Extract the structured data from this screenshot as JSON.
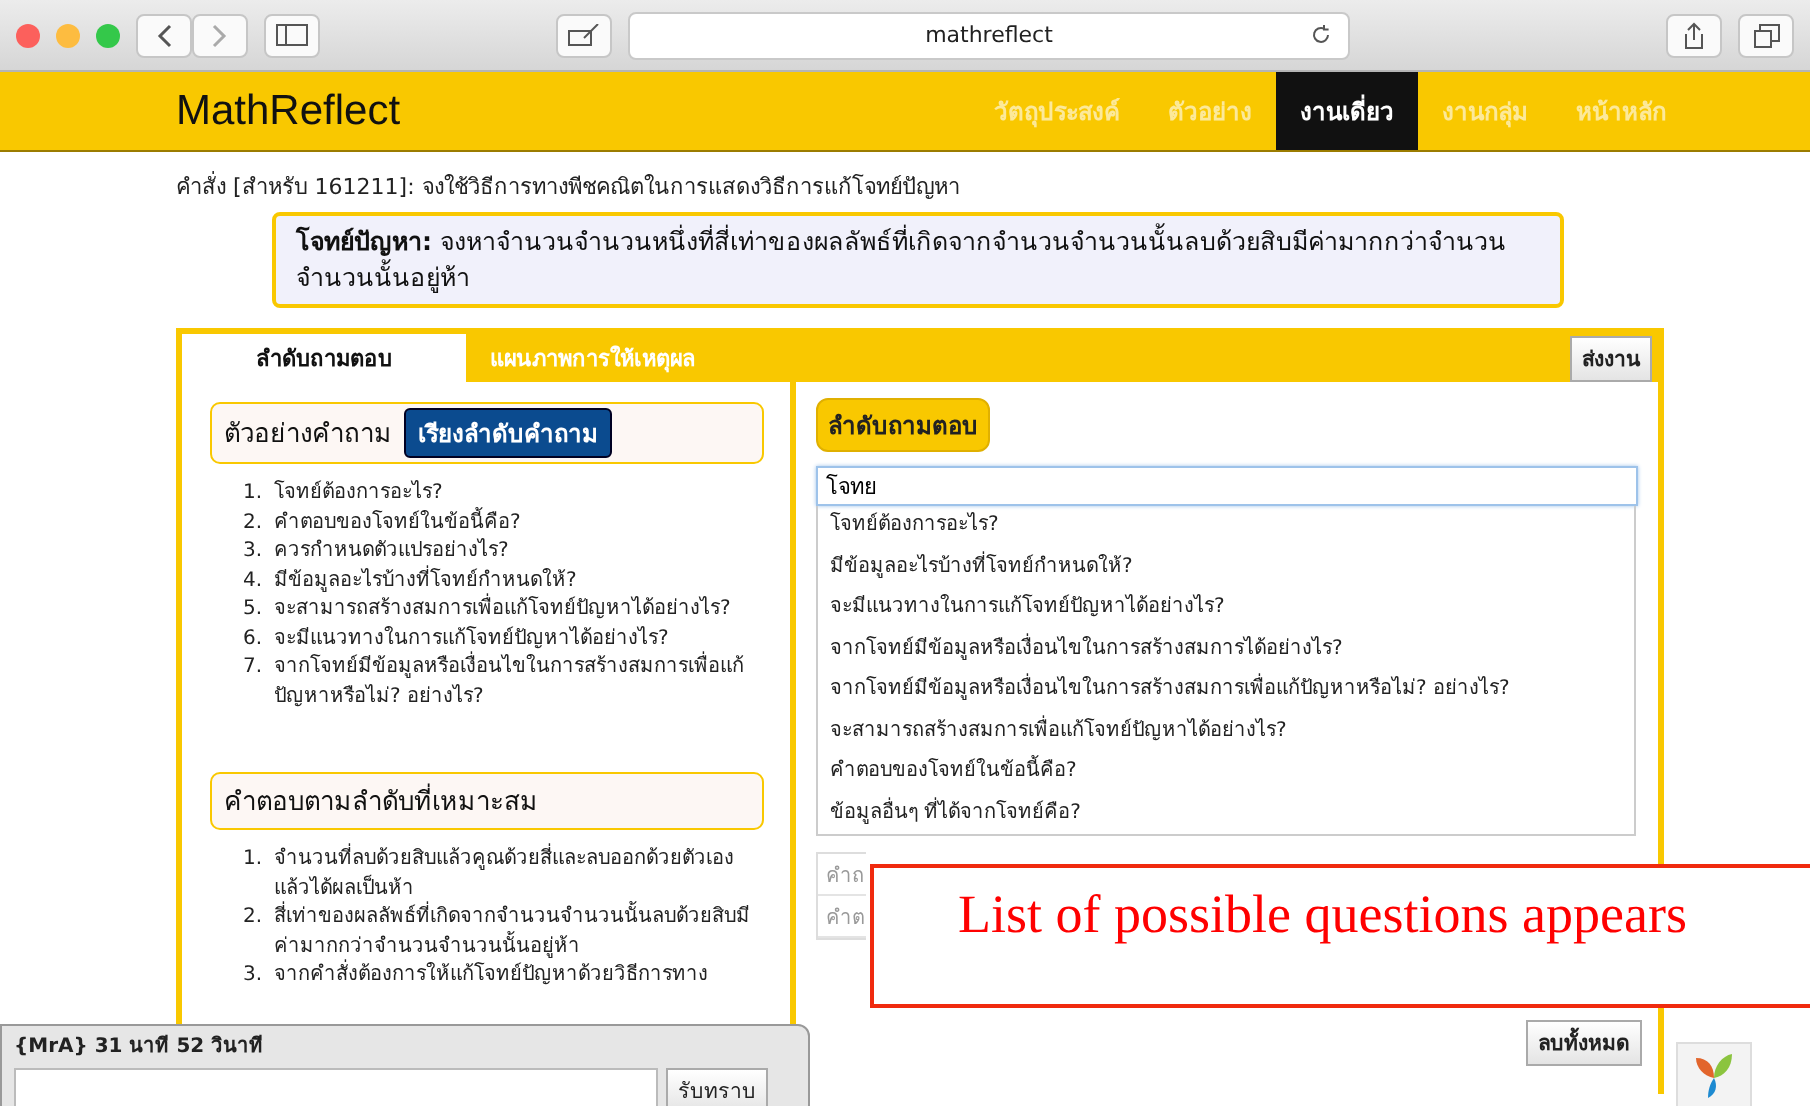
{
  "browser": {
    "url": "mathreflect"
  },
  "nav": {
    "logo": "MathReflect",
    "items": [
      {
        "label": "วัตถุประสงค์",
        "selected": false
      },
      {
        "label": "ตัวอย่าง",
        "selected": false
      },
      {
        "label": "งานเดี่ยว",
        "selected": true
      },
      {
        "label": "งานกลุ่ม",
        "selected": false
      },
      {
        "label": "หน้าหลัก",
        "selected": false
      }
    ]
  },
  "instruction": "คำสั่ง [สำหรับ 161211]: จงใช้วิธีการทางพีชคณิตในการแสดงวิธีการแก้โจทย์ปัญหา",
  "problem": "**โจทย์ปัญหา:** จงหาจำนวนจำนวนหนึ่งที่สี่เท่าของผลลัพธ์ที่เกิดจากจำนวนจำนวนนั้นลบด้วยสิบมีค่ามากกว่าจำนวนจำนวนนั้นอยู่ห้า",
  "tabs": [
    {
      "label": "ลำดับถามตอบ",
      "selected": true
    },
    {
      "label": "แผนภาพการให้เหตุผล",
      "selected": false
    }
  ],
  "submit_button": "ส่งงาน",
  "examples": {
    "title": "ตัวอย่างคำถาม",
    "sort_button": "เรียงลำดับคำถาม",
    "items": [
      {
        "number": "1.",
        "text": "โจทย์ต้องการอะไร?"
      },
      {
        "number": "2.",
        "text": "คำตอบของโจทย์ในข้อนี้คือ?"
      },
      {
        "number": "3.",
        "text": "ควรกำหนดตัวแปรอย่างไร?"
      },
      {
        "number": "4.",
        "text": "มีข้อมูลอะไรบ้างที่โจทย์กำหนดให้?"
      },
      {
        "number": "5.",
        "text": "จะสามารถสร้างสมการเพื่อแก้โจทย์ปัญหาได้อย่างไร?"
      },
      {
        "number": "6.",
        "text": "จะมีแนวทางในการแก้โจทย์ปัญหาได้อย่างไร?"
      },
      {
        "number": "7.",
        "text": "จากโจทย์มีข้อมูลหรือเงื่อนไขในการสร้างสมการเพื่อแก้ปัญหาหรือไม่? อย่างไร?"
      }
    ]
  },
  "answers": {
    "title": "คำตอบตามลำดับที่เหมาะสม",
    "items": [
      {
        "number": "1.",
        "text": "จำนวนที่ลบด้วยสิบแล้วคูณด้วยสี่และลบออกด้วยตัวเองแล้วได้ผลเป็นห้า"
      },
      {
        "number": "2.",
        "text": "สี่เท่าของผลลัพธ์ที่เกิดจากจำนวนจำนวนนั้นลบด้วยสิบมีค่ามากกว่าจำนวนจำนวนนั้นอยู่ห้า"
      },
      {
        "number": "3.",
        "text": "จากคำสั่งต้องการให้แก้โจทย์ปัญหาด้วยวิธีการทาง"
      }
    ]
  },
  "qa": {
    "title": "ลำดับถามตอบ",
    "input_value": "โจทย",
    "suggestions": [
      "โจทย์ต้องการอะไร?",
      "มีข้อมูลอะไรบ้างที่โจทย์กำหนดให้?",
      "จะมีแนวทางในการแก้โจทย์ปัญหาได้อย่างไร?",
      "จากโจทย์มีข้อมูลหรือเงื่อนไขในการสร้างสมการได้อย่างไร?",
      "จากโจทย์มีข้อมูลหรือเงื่อนไขในการสร้างสมการเพื่อแก้ปัญหาหรือไม่? อย่างไร?",
      "จะสามารถสร้างสมการเพื่อแก้โจทย์ปัญหาได้อย่างไร?",
      "คำตอบของโจทย์ในข้อนี้คือ?",
      "ข้อมูลอื่นๆ ที่ได้จากโจทย์คือ?"
    ],
    "fields": [
      "คำถ",
      "คำต"
    ],
    "clear_button": "ลบทั้งหมด"
  },
  "callout": "List of possible questions appears",
  "chat": {
    "header": "{MrA} 31 นาที 52 วินาที",
    "ack_button": "รับทราบ"
  }
}
